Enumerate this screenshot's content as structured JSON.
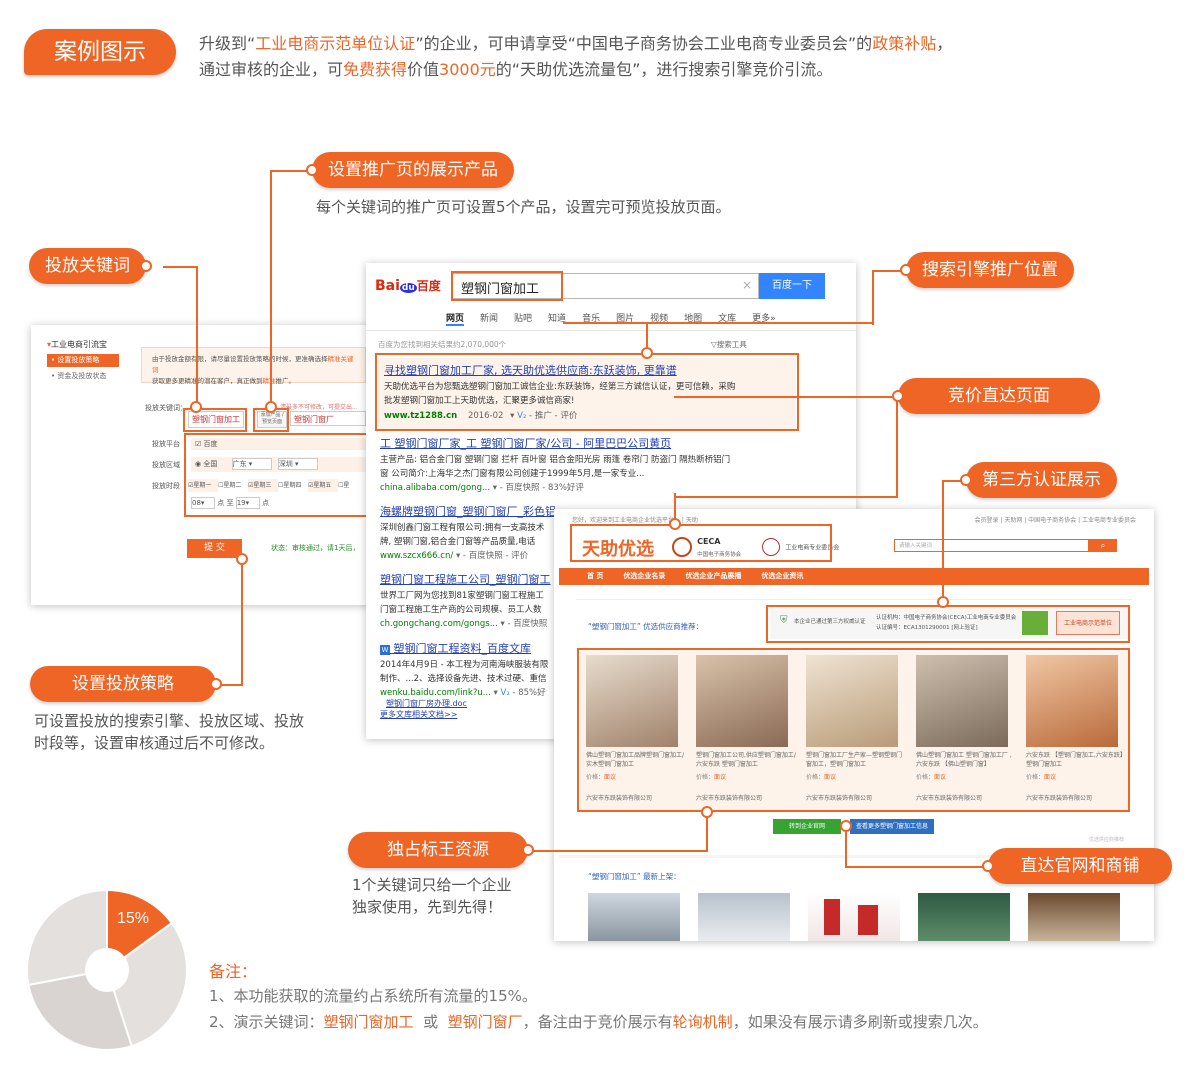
{
  "header": {
    "badge": "案例图示",
    "line1": {
      "p1": "升级到“",
      "h1": "工业电商示范单位认证",
      "p2": "”的企业，可申请享受“中国电子商务协会工业电商专业委员会”的",
      "h2": "政策补贴",
      "p3": "，"
    },
    "line2": {
      "p1": "通过审核的企业，可",
      "h1": "免费获得",
      "p2": "价值",
      "h2": "3000元",
      "p3": "的“天助优选流量包”，进行搜索引擎竞价引流。"
    }
  },
  "callouts": {
    "set_products": "设置推广页的展示产品",
    "set_products_desc": "每个关键词的推广页可设置5个产品，设置完可预览投放页面。",
    "keywords": "投放关键词",
    "search_position": "搜索引擎推广位置",
    "direct_page": "竞价直达页面",
    "third_party": "第三方认证展示",
    "strategy": "设置投放策略",
    "strategy_desc1": "可设置投放的搜索引擎、投放区域、投放",
    "strategy_desc2": "时段等，设置审核通过后不可修改。",
    "exclusive": "独占标王资源",
    "exclusive_desc1": "1个关键词只给一个企业",
    "exclusive_desc2": "独家使用，先到先得！",
    "official": "直达官网和商铺"
  },
  "pie": {
    "percent_label": "15%",
    "highlight_share": 0.15,
    "color_highlight": "#ee6526",
    "color_rest": "#e4e0de"
  },
  "notes": {
    "title": "备注：",
    "n1": "1、本功能获取的流量约占系统所有流量的15%。",
    "n2_p1": "2、演示关键词：",
    "n2_k1": "塑钢门窗加工",
    "n2_p2": "  或  ",
    "n2_k2": "塑钢门窗厂",
    "n2_p3": "，备注由于竞价展示有",
    "n2_k3": "轮询机制",
    "n2_p4": "，如果没有展示请多刷新或搜索几次。"
  },
  "admin": {
    "sidebar_title": "工业电商引流宝",
    "sidebar_item1": "• 设置投放策略",
    "sidebar_item2": "• 资金及投放状态",
    "notice1": "由于投放金额有限，请尽量设置投放策略的时候，更准确选择",
    "notice_hl": "精准关键词",
    "notice2": "获取更多更精准的潜在客户，真正做到",
    "notice_hl2": "精准",
    "notice3": "推广。",
    "kw_label": "投放关键词：",
    "kw1": "塑钢门窗加工",
    "kw_add": "添加产品 / 预览页面",
    "kw2": "塑钢门窗厂",
    "kw_hint": "请最多不可修改，可提交出...",
    "platform_label": "投放平台",
    "platform_value": "百度",
    "region_label": "投放区域",
    "region_all": "全国",
    "region_p1": "广东",
    "region_p2": "深圳",
    "time_label": "投放时段",
    "days": [
      "星期一",
      "星期二",
      "星期三",
      "星期四",
      "星期五",
      "星"
    ],
    "time_from": "08",
    "time_to_label": "至",
    "time_to": "19",
    "time_unit": "点",
    "submit": "提 交",
    "status": "状态：审核通过，请1天后，"
  },
  "baidu": {
    "logo_bai": "Bai",
    "logo_du": "du",
    "logo_cn": "百度",
    "query": "塑钢门窗加工",
    "search_btn": "百度一下",
    "tabs": [
      "网页",
      "新闻",
      "贴吧",
      "知道",
      "音乐",
      "图片",
      "视频",
      "地图",
      "文库",
      "更多»"
    ],
    "result_count": "百度为您找到相关结果约2,070,000个",
    "tools": "搜索工具",
    "ad": {
      "title": "寻找塑钢门窗加工厂家, 选天助优选供应商:东跃装饰, 更靠谱",
      "body1": "天助优选平台为您甄选塑钢门窗加工诚信企业:东跃装饰，经第三方诚信认证，更可信赖，采购",
      "body2": "批发塑钢门窗加工上天助优选，汇聚更多诚信商家!",
      "url": "www.tz1288.cn",
      "date": "2016-02",
      "tail": "推广 - 评价"
    },
    "r2": {
      "title": "工 塑钢门窗厂家_工 塑钢门窗厂家/公司 - 阿里巴巴公司黄页",
      "body1": "主营产品: 铝合金门窗 塑钢门窗 拦杆 百叶窗 铝合金阳光房 雨篷 卷帘门 防盗门 隔热断桥铝门",
      "body2": "窗 公司简介:上海华之杰门窗有限公司创建于1999年5月,是一家专业...",
      "url": "china.alibaba.com/gong...",
      "tail": "百度快照 - 83%好评"
    },
    "r3": {
      "title": "海螺牌塑钢门窗_塑钢门窗厂_彩色铝",
      "body1": "深圳创鑫门窗工程有限公司:拥有一支高技术",
      "body2": "牌, 塑钢门窗,铝合金门窗等产品质量,电话",
      "url": "www.szcx666.cn/",
      "tail": "百度快照 - 评价"
    },
    "r4": {
      "title": "塑钢门窗工程施工公司_塑钢门窗工",
      "body1": "世界工厂网为您找到81家塑钢门窗工程施工",
      "body2": "门窗工程施工生产商的公司规模、员工人数",
      "url": "ch.gongchang.com/gongs...",
      "tail": "百度快照"
    },
    "r5": {
      "title": "塑钢门窗工程资料_百度文库",
      "body1": "2014年4月9日 - 本工程为河南海峡服装有限",
      "body2": "制作、...2、选择设备先进、技术过硬、重信",
      "url": "wenku.baidu.com/link?u...",
      "tail": "85%好",
      "link": "塑钢门窗厂房办理.doc",
      "more": "更多文库相关文档>>"
    }
  },
  "tianzhu": {
    "top_left": "您好，欢迎来到工业电商企业优选平台！  | 天助",
    "top_right": "会员登录 | 天助网 | 中国电子商务协会 | 工业电商专业委员会",
    "logo": "天助优选",
    "ceca": "CECA",
    "ceca_sub": "中国电子商务协会",
    "committee": "工业电商专业委员会",
    "search_placeholder": "请输入关键词",
    "nav": [
      "首 页",
      "优选企业名录",
      "优选企业产品展播",
      "优选企业资讯"
    ],
    "recommend": "“塑钢门窗加工” 优选供应商推荐：",
    "cert1": "本企业已通过第三方权威认证",
    "cert2": "认证机构：中国电子商务协会(CECA)工业电商专业委员会",
    "cert3": "认证编号：ECA1301290001  [网上验证]",
    "badge_text": "工业电商示范单位",
    "products": [
      {
        "desc": "佛山塑钢门窗加工品牌塑钢门窗加工/实木塑钢门窗加工",
        "company": "六安市东跃装饰有限公司"
      },
      {
        "desc": "塑钢门窗加工公司,供应塑钢门窗加工/六安东跃  塑钢门窗加工",
        "company": "六安市东跃装饰有限公司"
      },
      {
        "desc": "塑钢门窗加工厂生产家—塑钢塑钢门窗加工，塑钢门窗加工",
        "company": "六安市东跃装饰有限公司"
      },
      {
        "desc": "佛山塑钢门窗加工 塑钢门窗加工厂 ,六安东跃 【佛山塑钢门窗】",
        "company": "六安市东跃装饰有限公司"
      },
      {
        "desc": "六安东跃 【塑钢门窗加工,六安东跃】 塑钢门窗加工",
        "company": "六安市东跃装饰有限公司"
      }
    ],
    "price_label": "价格：",
    "price_value": "面议",
    "btn_official": "转到企业官网",
    "btn_more": "查看更多塑钢门窗加工信息",
    "footer_note": "优选供应商推荐",
    "new_label": "“塑钢门窗加工” 最新上架："
  }
}
